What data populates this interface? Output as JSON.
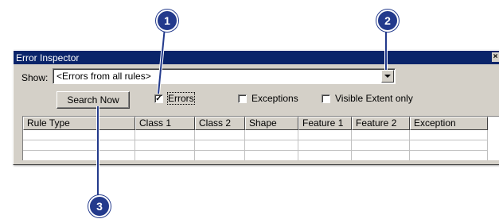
{
  "window": {
    "title": "Error Inspector",
    "close_glyph": "×"
  },
  "show": {
    "label": "Show:",
    "value": "<Errors from all rules>"
  },
  "search_button": {
    "label": "Search Now"
  },
  "checkboxes": [
    {
      "label": "Errors",
      "checked": true
    },
    {
      "label": "Exceptions",
      "checked": false
    },
    {
      "label": "Visible Extent only",
      "checked": false
    }
  ],
  "grid": {
    "columns": [
      "Rule Type",
      "Class 1",
      "Class 2",
      "Shape",
      "Feature 1",
      "Feature 2",
      "Exception"
    ],
    "rows": 3
  },
  "callouts": [
    "1",
    "2",
    "3"
  ],
  "colors": {
    "callout": "#233a8c",
    "titlebar": "#0a246a",
    "panel": "#d4d0c8"
  }
}
